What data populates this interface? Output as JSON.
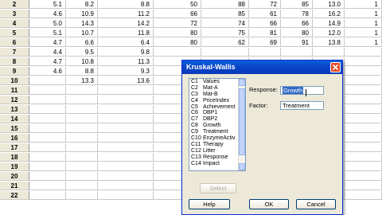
{
  "worksheet": {
    "rows": [
      {
        "num": "2",
        "cells": [
          "5.1",
          "8.2",
          "8.8",
          "50",
          "88",
          "72",
          "85",
          "13.0",
          "1"
        ]
      },
      {
        "num": "3",
        "cells": [
          "4.6",
          "10.9",
          "11.2",
          "66",
          "85",
          "61",
          "78",
          "16.2",
          "1"
        ]
      },
      {
        "num": "4",
        "cells": [
          "5.0",
          "14.3",
          "14.2",
          "72",
          "74",
          "66",
          "66",
          "14.9",
          "1"
        ]
      },
      {
        "num": "5",
        "cells": [
          "5.1",
          "10.7",
          "11.8",
          "80",
          "75",
          "81",
          "80",
          "12.0",
          "1"
        ]
      },
      {
        "num": "6",
        "cells": [
          "4.7",
          "6.6",
          "6.4",
          "80",
          "62",
          "69",
          "91",
          "13.8",
          "1"
        ]
      },
      {
        "num": "7",
        "cells": [
          "4.4",
          "9.5",
          "9.8",
          "",
          "",
          "",
          "",
          "",
          ""
        ]
      },
      {
        "num": "8",
        "cells": [
          "4.7",
          "10.8",
          "11.3",
          "",
          "",
          "",
          "",
          "",
          ""
        ]
      },
      {
        "num": "9",
        "cells": [
          "4.6",
          "8.8",
          "9.3",
          "",
          "",
          "",
          "",
          "",
          ""
        ]
      },
      {
        "num": "10",
        "cells": [
          "",
          "13.3",
          "13.6",
          "",
          "",
          "",
          "",
          "",
          ""
        ]
      },
      {
        "num": "11",
        "cells": [
          "",
          "",
          "",
          "",
          "",
          "",
          "",
          "",
          ""
        ]
      },
      {
        "num": "12",
        "cells": [
          "",
          "",
          "",
          "",
          "",
          "",
          "",
          "",
          ""
        ]
      },
      {
        "num": "13",
        "cells": [
          "",
          "",
          "",
          "",
          "",
          "",
          "",
          "",
          ""
        ]
      },
      {
        "num": "14",
        "cells": [
          "",
          "",
          "",
          "",
          "",
          "",
          "",
          "",
          ""
        ]
      },
      {
        "num": "15",
        "cells": [
          "",
          "",
          "",
          "",
          "",
          "",
          "",
          "",
          ""
        ]
      },
      {
        "num": "16",
        "cells": [
          "",
          "",
          "",
          "",
          "",
          "",
          "",
          "",
          ""
        ]
      },
      {
        "num": "17",
        "cells": [
          "",
          "",
          "",
          "",
          "",
          "",
          "",
          "",
          ""
        ]
      },
      {
        "num": "18",
        "cells": [
          "",
          "",
          "",
          "",
          "",
          "",
          "",
          "",
          ""
        ]
      },
      {
        "num": "19",
        "cells": [
          "",
          "",
          "",
          "",
          "",
          "",
          "",
          "",
          ""
        ]
      },
      {
        "num": "20",
        "cells": [
          "",
          "",
          "",
          "",
          "",
          "",
          "",
          "",
          ""
        ]
      },
      {
        "num": "21",
        "cells": [
          "",
          "",
          "",
          "",
          "",
          "",
          "",
          "",
          ""
        ]
      },
      {
        "num": "22",
        "cells": [
          "",
          "",
          "",
          "",
          "",
          "",
          "",
          "",
          ""
        ]
      }
    ]
  },
  "dialog": {
    "title": "Kruskal-Wallis",
    "columns": [
      {
        "col": "C1",
        "name": "Values"
      },
      {
        "col": "C2",
        "name": "Mat-A"
      },
      {
        "col": "C3",
        "name": "Mat-B"
      },
      {
        "col": "C4",
        "name": "PriceIndex"
      },
      {
        "col": "C5",
        "name": "Achievement"
      },
      {
        "col": "C6",
        "name": "DBP1"
      },
      {
        "col": "C7",
        "name": "DBP2"
      },
      {
        "col": "C8",
        "name": "Growth"
      },
      {
        "col": "C9",
        "name": "Treatment"
      },
      {
        "col": "C10",
        "name": "EnzymeActiv"
      },
      {
        "col": "C11",
        "name": "Therapy"
      },
      {
        "col": "C12",
        "name": "Litter"
      },
      {
        "col": "C13",
        "name": "Response"
      },
      {
        "col": "C14",
        "name": "Impact"
      }
    ],
    "response_label": "Response:",
    "response_value": "Growth",
    "factor_label": "Factor:",
    "factor_value": "Treatment",
    "select_label": "Select",
    "help_label": "Help",
    "ok_label": "OK",
    "cancel_label": "Cancel",
    "colors": {
      "titlebar": "#0b45c9",
      "selection": "#316ac5",
      "close": "#e24b26"
    }
  }
}
